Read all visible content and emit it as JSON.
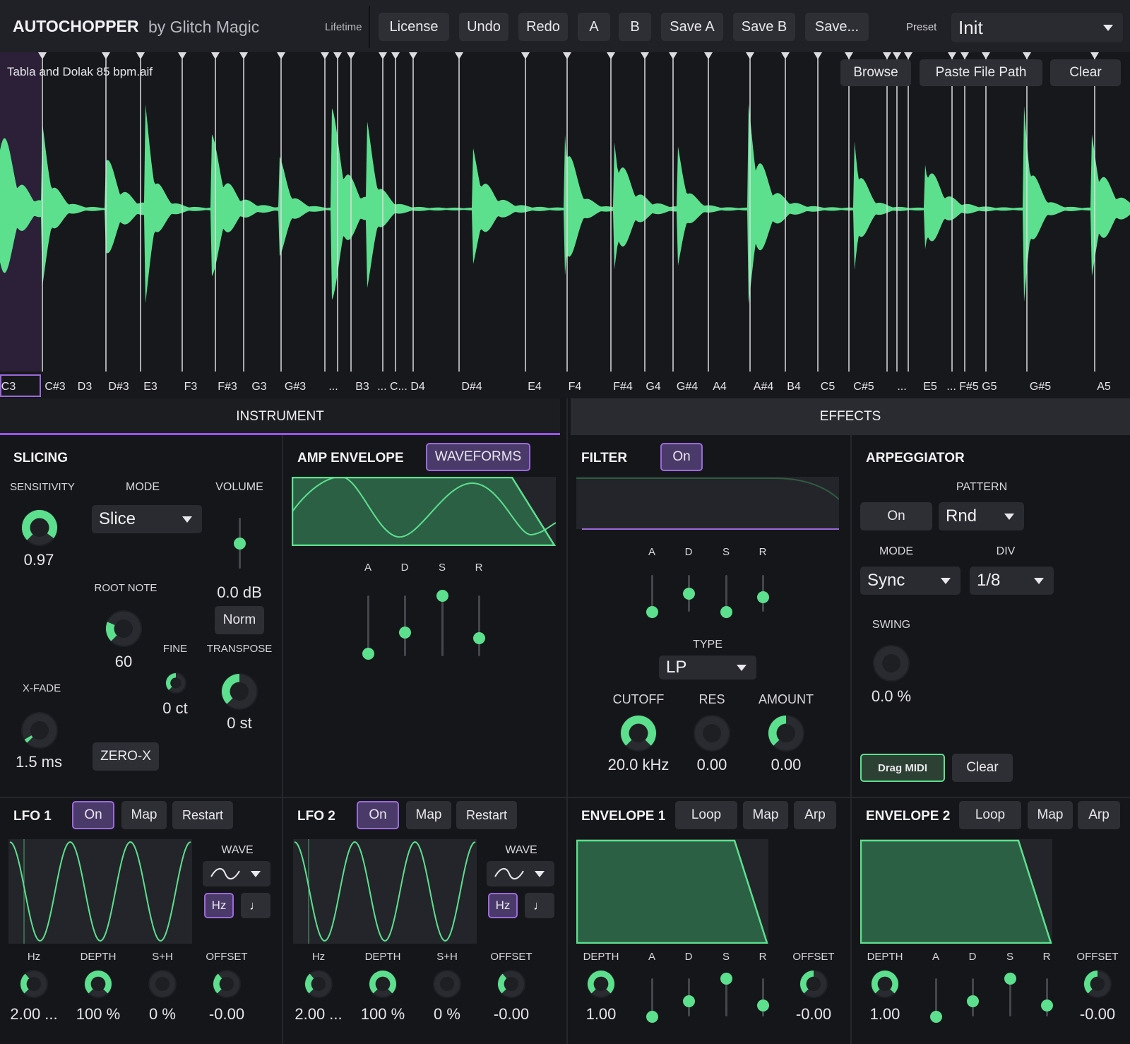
{
  "header": {
    "app_title": "AUTOCHOPPER",
    "by_line": "by Glitch Magic",
    "edition": "Lifetime",
    "buttons": [
      "License",
      "Undo",
      "Redo",
      "A",
      "B",
      "Save A",
      "Save B",
      "Save..."
    ],
    "preset_label": "Preset",
    "preset_value": "Init"
  },
  "waveform": {
    "file_name": "Tabla and Dolak 85 bpm.aif",
    "buttons": [
      "Browse",
      "Paste File Path",
      "Clear"
    ],
    "notes": [
      "C3",
      "C#3",
      "D3",
      "D#3",
      "E3",
      "F3",
      "F#3",
      "G3",
      "G#3",
      "...",
      "B3",
      "... C... D4",
      "D#4",
      "E4",
      "F4",
      "F#4",
      "G4",
      "G#4",
      "A4",
      "A#4",
      "B4",
      "C5",
      "C#5",
      "...",
      "E5",
      "... F#5 G5",
      "G#5",
      "A5"
    ],
    "selected_note": "C3",
    "color": "#5ce08e",
    "selection_color": "#2b2038"
  },
  "tabs": {
    "instrument": "INSTRUMENT",
    "effects": "EFFECTS",
    "active": "INSTRUMENT"
  },
  "slicing": {
    "title": "SLICING",
    "sensitivity_label": "SENSITIVITY",
    "sensitivity_value": "0.97",
    "mode_label": "MODE",
    "mode_value": "Slice",
    "volume_label": "VOLUME",
    "volume_value": "0.0 dB",
    "norm_label": "Norm",
    "root_note_label": "ROOT NOTE",
    "root_note_value": "60",
    "fine_label": "FINE",
    "fine_value": "0 ct",
    "transpose_label": "TRANSPOSE",
    "transpose_value": "0 st",
    "xfade_label": "X-FADE",
    "xfade_value": "1.5 ms",
    "zerox_label": "ZERO-X"
  },
  "amp_envelope": {
    "title": "AMP ENVELOPE",
    "waveforms_label": "WAVEFORMS",
    "adsr_labels": [
      "A",
      "D",
      "S",
      "R"
    ],
    "adsr_levels": [
      0.05,
      0.4,
      1.0,
      0.3
    ]
  },
  "filter": {
    "title": "FILTER",
    "on_label": "On",
    "adsr_labels": [
      "A",
      "D",
      "S",
      "R"
    ],
    "adsr_levels": [
      0.0,
      0.5,
      0.0,
      0.4
    ],
    "type_label": "TYPE",
    "type_value": "LP",
    "cutoff_label": "CUTOFF",
    "cutoff_value": "20.0 kHz",
    "res_label": "RES",
    "res_value": "0.00",
    "amount_label": "AMOUNT",
    "amount_value": "0.00"
  },
  "arpeggiator": {
    "title": "ARPEGGIATOR",
    "pattern_label": "PATTERN",
    "on_label": "On",
    "pattern_value": "Rnd",
    "mode_label": "MODE",
    "mode_value": "Sync",
    "div_label": "DIV",
    "div_value": "1/8",
    "swing_label": "SWING",
    "swing_value": "0.0 %",
    "drag_midi_label": "Drag MIDI",
    "clear_label": "Clear"
  },
  "lfo1": {
    "title": "LFO 1",
    "on_label": "On",
    "map_label": "Map",
    "restart_label": "Restart",
    "wave_label": "WAVE",
    "hz_label": "Hz",
    "note_label": "♩",
    "knob_labels": [
      "Hz",
      "DEPTH",
      "S+H",
      "OFFSET"
    ],
    "knob_values": [
      "2.00 ...",
      "100 %",
      "0 %",
      "-0.00"
    ]
  },
  "lfo2": {
    "title": "LFO 2",
    "on_label": "On",
    "map_label": "Map",
    "restart_label": "Restart",
    "wave_label": "WAVE",
    "hz_label": "Hz",
    "note_label": "♩",
    "knob_labels": [
      "Hz",
      "DEPTH",
      "S+H",
      "OFFSET"
    ],
    "knob_values": [
      "2.00 ...",
      "100 %",
      "0 %",
      "-0.00"
    ]
  },
  "envelope1": {
    "title": "ENVELOPE 1",
    "loop_label": "Loop",
    "map_label": "Map",
    "arp_label": "Arp",
    "labels": [
      "DEPTH",
      "A",
      "D",
      "S",
      "R",
      "OFFSET"
    ],
    "depth_value": "1.00",
    "offset_value": "-0.00",
    "adsr_levels": [
      0.0,
      0.4,
      1.0,
      0.3
    ]
  },
  "envelope2": {
    "title": "ENVELOPE 2",
    "loop_label": "Loop",
    "map_label": "Map",
    "arp_label": "Arp",
    "labels": [
      "DEPTH",
      "A",
      "D",
      "S",
      "R",
      "OFFSET"
    ],
    "depth_value": "1.00",
    "offset_value": "-0.00",
    "adsr_levels": [
      0.0,
      0.4,
      1.0,
      0.3
    ]
  }
}
